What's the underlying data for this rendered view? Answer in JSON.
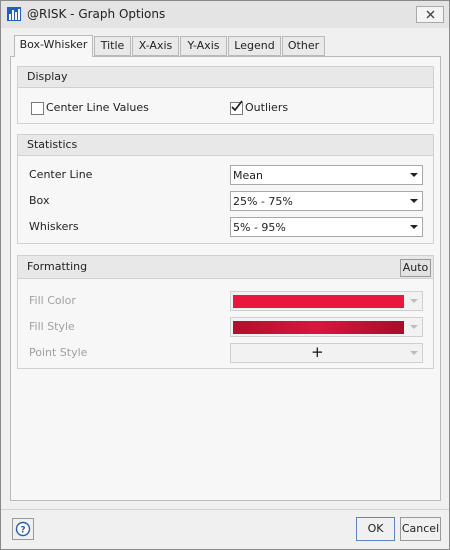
{
  "window": {
    "title": "@RISK - Graph Options"
  },
  "tabs": [
    {
      "label": "Box-Whisker",
      "active": true
    },
    {
      "label": "Title"
    },
    {
      "label": "X-Axis"
    },
    {
      "label": "Y-Axis"
    },
    {
      "label": "Legend"
    },
    {
      "label": "Other"
    }
  ],
  "display": {
    "header": "Display",
    "center_line_values": {
      "label": "Center Line Values",
      "checked": false
    },
    "outliers": {
      "label": "Outliers",
      "checked": true
    }
  },
  "statistics": {
    "header": "Statistics",
    "center_line": {
      "label": "Center Line",
      "value": "Mean"
    },
    "box": {
      "label": "Box",
      "value": "25% - 75%"
    },
    "whiskers": {
      "label": "Whiskers",
      "value": "5% - 95%"
    }
  },
  "formatting": {
    "header": "Formatting",
    "auto_label": "Auto",
    "fill_color": {
      "label": "Fill Color",
      "color": "#e8173d"
    },
    "fill_style": {
      "label": "Fill Style",
      "color": "#c8102e"
    },
    "point_style": {
      "label": "Point Style",
      "symbol": "+"
    }
  },
  "buttons": {
    "ok": "OK",
    "cancel": "Cancel"
  },
  "icons": {
    "app": "chart-icon",
    "close": "close-icon",
    "help": "help-icon"
  }
}
